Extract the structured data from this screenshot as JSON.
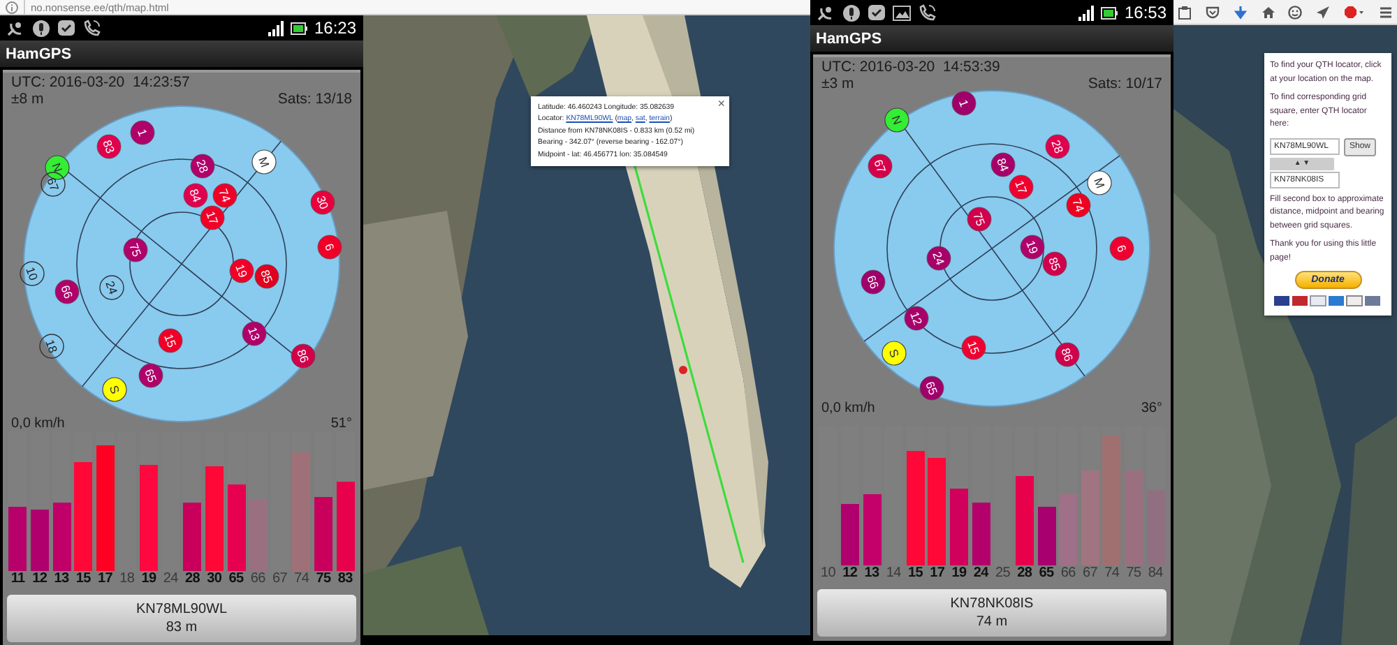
{
  "browser": {
    "url": "no.nonsense.ee/qth/map.html"
  },
  "phones": [
    {
      "notifications": [
        {
          "kind": "satellite"
        },
        {
          "kind": "microphone"
        },
        {
          "kind": "check"
        },
        {
          "kind": "phone"
        }
      ],
      "time": "16:23",
      "app_title": "HamGPS",
      "utc": "UTC: 2016-03-20  14:23:57",
      "accuracy": "±8 m",
      "sats": "Sats: 13/18",
      "speed": "0,0 km/h",
      "heading": "51°",
      "sky": [
        {
          "label": "1",
          "kind": "sat",
          "color": "#b0006a"
        },
        {
          "label": "83",
          "kind": "sat",
          "color": "#e0004d"
        },
        {
          "label": "N",
          "kind": "compass",
          "color": "#33ee33"
        },
        {
          "label": "67",
          "kind": "unused"
        },
        {
          "label": "28",
          "kind": "sat",
          "color": "#b0006a"
        },
        {
          "label": "M",
          "kind": "compass",
          "color": "#ffffff"
        },
        {
          "label": "84",
          "kind": "sat",
          "color": "#e0004d"
        },
        {
          "label": "74",
          "kind": "sat",
          "color": "#f00028"
        },
        {
          "label": "17",
          "kind": "sat",
          "color": "#f00028"
        },
        {
          "label": "30",
          "kind": "sat",
          "color": "#e8003c"
        },
        {
          "label": "6",
          "kind": "sat",
          "color": "#f00028"
        },
        {
          "label": "75",
          "kind": "sat",
          "color": "#b0006a"
        },
        {
          "label": "19",
          "kind": "sat",
          "color": "#f00028"
        },
        {
          "label": "85",
          "kind": "sat",
          "color": "#e00020"
        },
        {
          "label": "10",
          "kind": "unused"
        },
        {
          "label": "66",
          "kind": "sat",
          "color": "#b0006a"
        },
        {
          "label": "24",
          "kind": "unused"
        },
        {
          "label": "18",
          "kind": "unused"
        },
        {
          "label": "15",
          "kind": "sat",
          "color": "#f00028"
        },
        {
          "label": "13",
          "kind": "sat",
          "color": "#b0006a"
        },
        {
          "label": "86",
          "kind": "sat",
          "color": "#d0004a"
        },
        {
          "label": "S",
          "kind": "compass",
          "color": "#ffff00"
        },
        {
          "label": "65",
          "kind": "sat",
          "color": "#b0006a"
        }
      ],
      "bars": [
        {
          "label": "11",
          "used": true,
          "level": 0.46,
          "color": "#b8006a"
        },
        {
          "label": "12",
          "used": true,
          "level": 0.44,
          "color": "#b0006e"
        },
        {
          "label": "13",
          "used": true,
          "level": 0.49,
          "color": "#c00068"
        },
        {
          "label": "15",
          "used": true,
          "level": 0.78,
          "color": "#ff0838"
        },
        {
          "label": "17",
          "used": true,
          "level": 0.9,
          "color": "#ff0022"
        },
        {
          "label": "18",
          "used": false
        },
        {
          "label": "19",
          "used": true,
          "level": 0.76,
          "color": "#ff0840"
        },
        {
          "label": "24",
          "used": false
        },
        {
          "label": "28",
          "used": true,
          "level": 0.49,
          "color": "#c8005c"
        },
        {
          "label": "30",
          "used": true,
          "level": 0.75,
          "color": "#ff0838"
        },
        {
          "label": "65",
          "used": true,
          "level": 0.62,
          "color": "#e80050"
        },
        {
          "label": "66",
          "used": false,
          "level": 0.51,
          "color": "#9a7080"
        },
        {
          "label": "67",
          "used": false
        },
        {
          "label": "74",
          "used": false,
          "level": 0.85,
          "color": "#a07078"
        },
        {
          "label": "75",
          "used": true,
          "level": 0.53,
          "color": "#c8005c"
        },
        {
          "label": "83",
          "used": true,
          "level": 0.64,
          "color": "#e8004c"
        }
      ],
      "locator": "KN78ML90WL",
      "distance": "83 m"
    },
    {
      "notifications": [
        {
          "kind": "satellite"
        },
        {
          "kind": "microphone"
        },
        {
          "kind": "check"
        },
        {
          "kind": "image"
        },
        {
          "kind": "phone"
        }
      ],
      "time": "16:53",
      "app_title": "HamGPS",
      "utc": "UTC: 2016-03-20  14:53:39",
      "accuracy": "±3 m",
      "sats": "Sats: 10/17",
      "speed": "0,0 km/h",
      "heading": "36°",
      "sky": [
        {
          "label": "1",
          "kind": "sat",
          "color": "#a0006a"
        },
        {
          "label": "N",
          "kind": "compass",
          "color": "#33ee33"
        },
        {
          "label": "67",
          "kind": "sat",
          "color": "#d5004a"
        },
        {
          "label": "28",
          "kind": "sat",
          "color": "#e0004e"
        },
        {
          "label": "84",
          "kind": "sat",
          "color": "#a8006a"
        },
        {
          "label": "17",
          "kind": "sat",
          "color": "#f00030"
        },
        {
          "label": "M",
          "kind": "compass",
          "color": "#ffffff"
        },
        {
          "label": "74",
          "kind": "sat",
          "color": "#ee0022"
        },
        {
          "label": "75",
          "kind": "sat",
          "color": "#d0004c"
        },
        {
          "label": "6",
          "kind": "sat",
          "color": "#f00030"
        },
        {
          "label": "19",
          "kind": "sat",
          "color": "#b0006a"
        },
        {
          "label": "85",
          "kind": "sat",
          "color": "#d0004c"
        },
        {
          "label": "24",
          "kind": "sat",
          "color": "#a8006a"
        },
        {
          "label": "66",
          "kind": "sat",
          "color": "#a0006a"
        },
        {
          "label": "12",
          "kind": "sat",
          "color": "#a8006a"
        },
        {
          "label": "S",
          "kind": "compass",
          "color": "#ffff00"
        },
        {
          "label": "15",
          "kind": "sat",
          "color": "#f00030"
        },
        {
          "label": "86",
          "kind": "sat",
          "color": "#d0004c"
        },
        {
          "label": "65",
          "kind": "sat",
          "color": "#a0006a"
        }
      ],
      "bars": [
        {
          "label": "10",
          "used": false
        },
        {
          "label": "12",
          "used": true,
          "level": 0.44,
          "color": "#b0006e"
        },
        {
          "label": "13",
          "used": true,
          "level": 0.51,
          "color": "#c4006a"
        },
        {
          "label": "14",
          "used": false
        },
        {
          "label": "15",
          "used": true,
          "level": 0.82,
          "color": "#ff0838"
        },
        {
          "label": "17",
          "used": true,
          "level": 0.77,
          "color": "#ff0838"
        },
        {
          "label": "19",
          "used": true,
          "level": 0.55,
          "color": "#d0005c"
        },
        {
          "label": "24",
          "used": true,
          "level": 0.45,
          "color": "#b4006a"
        },
        {
          "label": "25",
          "used": false
        },
        {
          "label": "28",
          "used": true,
          "level": 0.64,
          "color": "#e8004c"
        },
        {
          "label": "65",
          "used": true,
          "level": 0.42,
          "color": "#a8006e"
        },
        {
          "label": "66",
          "used": false,
          "level": 0.51,
          "color": "#a07088"
        },
        {
          "label": "67",
          "used": false,
          "level": 0.68,
          "color": "#a07480"
        },
        {
          "label": "74",
          "used": false,
          "level": 0.93,
          "color": "#a07070"
        },
        {
          "label": "75",
          "used": false,
          "level": 0.68,
          "color": "#9a7080"
        },
        {
          "label": "84",
          "used": false,
          "level": 0.54,
          "color": "#907080"
        }
      ],
      "locator": "KN78NK08IS",
      "distance": "74 m"
    }
  ],
  "map_popup": {
    "coordinates": "Latitude: 46.460243  Longitude: 35.082639",
    "locator_line": [
      {
        "kind": "text",
        "text": "Locator:"
      },
      {
        "kind": "link",
        "text": "KN78ML90WL"
      },
      {
        "kind": "text",
        "text": "("
      },
      {
        "kind": "link",
        "text": "map"
      },
      {
        "kind": "text",
        "text": ","
      },
      {
        "kind": "link",
        "text": "sat"
      },
      {
        "kind": "text",
        "text": ","
      },
      {
        "kind": "link",
        "text": "terrain"
      },
      {
        "kind": "text",
        "text": ")"
      }
    ],
    "distance": "Distance from KN78NK08IS - 0.833 km (0.52 mi)",
    "bearing": "Bearing - 342.07° (reverse bearing - 162.07°)",
    "midpoint": "Midpoint - lat: 46.456771 lon: 35.084549",
    "close": "×"
  },
  "qth_panel": {
    "intro": "To find your QTH locator, click at your location on the map.",
    "prompt": "To find corresponding grid square, enter QTH locator here:",
    "first_locator": "KN78ML90WL",
    "show_button": "Show",
    "swap_button": "▲ ▼",
    "second_locator": "KN78NK08IS",
    "hint": "Fill second box to approximate distance, midpoint and bearing between grid squares.",
    "thanks": "Thank you for using this little page!",
    "donate": "Donate"
  }
}
